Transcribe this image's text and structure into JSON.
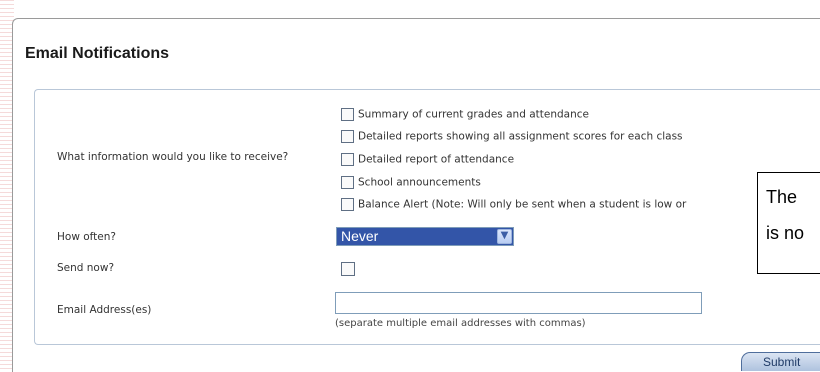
{
  "section_title": "Email Notifications",
  "questions": {
    "info_label": "What information would you like to receive?",
    "frequency_label": "How often?",
    "send_now_label": "Send now?",
    "email_label": "Email Address(es)"
  },
  "options": [
    {
      "label": "Summary of current grades and attendance",
      "checked": false
    },
    {
      "label": "Detailed reports showing all assignment scores for each class",
      "checked": false
    },
    {
      "label": "Detailed report of attendance",
      "checked": false
    },
    {
      "label": "School announcements",
      "checked": false
    },
    {
      "label": "Balance Alert (Note: Will only be sent when a student is low or",
      "checked": false
    }
  ],
  "frequency": {
    "selected": "Never"
  },
  "send_now": {
    "checked": false
  },
  "email": {
    "value": "",
    "hint": "(separate multiple email addresses with commas)"
  },
  "callout": {
    "line1": "The",
    "line2": "is no"
  },
  "submit_label": "Submit",
  "colors": {
    "select_bg": "#3355a8",
    "box_border": "#b9c7d8",
    "stripe": "#f5dada"
  }
}
